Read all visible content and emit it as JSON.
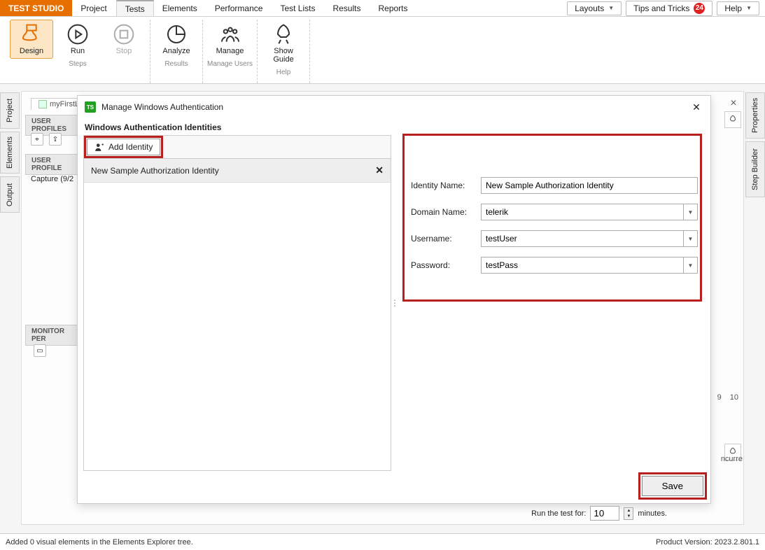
{
  "brand": "TEST STUDIO",
  "menu": {
    "project": "Project",
    "tests": "Tests",
    "elements": "Elements",
    "performance": "Performance",
    "testlists": "Test Lists",
    "results": "Results",
    "reports": "Reports"
  },
  "topright": {
    "layouts": "Layouts",
    "tips": "Tips and Tricks",
    "tips_badge": "24",
    "help": "Help"
  },
  "ribbon": {
    "design": "Design",
    "run": "Run",
    "stop": "Stop",
    "analyze": "Analyze",
    "manage": "Manage",
    "guide": "Show\nGuide",
    "g_steps": "Steps",
    "g_results": "Results",
    "g_users": "Manage Users",
    "g_help": "Help"
  },
  "sidetabs": {
    "project": "Project",
    "elements": "Elements",
    "output": "Output",
    "properties": "Properties",
    "stepbuilder": "Step Builder"
  },
  "bg": {
    "doc_tab": "myFirstLo",
    "user_profiles": "USER PROFILES",
    "user_profile": "USER PROFILE",
    "capture": "Capture (9/2",
    "monitor": "MONITOR PER"
  },
  "dialog": {
    "title": "Manage Windows Authentication",
    "subtitle": "Windows Authentication Identities",
    "add_identity": "Add Identity",
    "identity_item": "New Sample Authorization Identity",
    "form": {
      "identity_label": "Identity Name:",
      "identity_value": "New Sample Authorization Identity",
      "domain_label": "Domain Name:",
      "domain_value": "telerik",
      "user_label": "Username:",
      "user_value": "testUser",
      "pass_label": "Password:",
      "pass_value": "testPass"
    },
    "save": "Save"
  },
  "runfor": {
    "label": "Run the test for:",
    "value": "10",
    "unit": "minutes."
  },
  "numbers": {
    "n1": "9",
    "n2": "10"
  },
  "ncurre": "ncurre",
  "status": {
    "msg": "Added 0 visual elements in the Elements Explorer tree.",
    "version": "Product Version: 2023.2.801.1"
  }
}
